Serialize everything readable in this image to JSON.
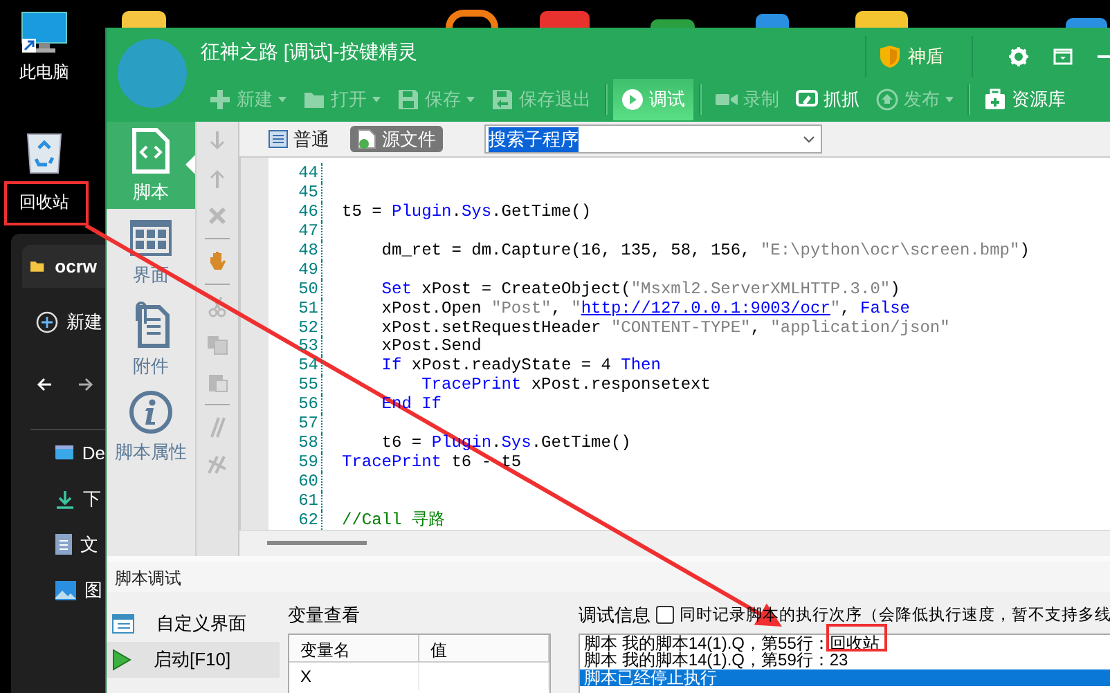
{
  "desktop": {
    "icons": [
      {
        "label": "此电脑",
        "kind": "computer"
      },
      {
        "label": "回收站",
        "kind": "recycle"
      }
    ]
  },
  "explorer": {
    "tab": "ocrw",
    "new_button": "新建",
    "nav": [
      {
        "label": "De",
        "kind": "desktop"
      },
      {
        "label": "下",
        "kind": "download"
      },
      {
        "label": "文",
        "kind": "document"
      },
      {
        "label": "图",
        "kind": "picture"
      }
    ]
  },
  "window": {
    "title": "征神之路 [调试]-按键精灵",
    "shield": "神盾"
  },
  "toolbar": [
    {
      "label": "新建",
      "disabled": true,
      "dropdown": true,
      "selected": false
    },
    {
      "label": "打开",
      "disabled": true,
      "dropdown": true,
      "selected": false
    },
    {
      "label": "保存",
      "disabled": true,
      "dropdown": true,
      "selected": false
    },
    {
      "label": "保存退出",
      "disabled": true,
      "dropdown": false,
      "selected": false
    },
    {
      "label": "调试",
      "disabled": false,
      "dropdown": false,
      "selected": true
    },
    {
      "label": "录制",
      "disabled": true,
      "dropdown": false,
      "selected": false
    },
    {
      "label": "抓抓",
      "disabled": false,
      "dropdown": false,
      "selected": false
    },
    {
      "label": "发布",
      "disabled": true,
      "dropdown": true,
      "selected": false
    },
    {
      "label": "资源库",
      "disabled": false,
      "dropdown": false,
      "selected": false
    }
  ],
  "sidebar": {
    "items": [
      {
        "label": "脚本",
        "selected": true
      },
      {
        "label": "界面",
        "selected": false
      },
      {
        "label": "附件",
        "selected": false
      },
      {
        "label": "脚本属性",
        "selected": false
      }
    ]
  },
  "editor": {
    "view_tabs": [
      {
        "label": "普通",
        "selected": false
      },
      {
        "label": "源文件",
        "selected": true
      }
    ],
    "procedure_search": {
      "value": "搜索子程序"
    },
    "lines": [
      {
        "number": "44"
      },
      {
        "number": "45"
      },
      {
        "number": "46",
        "segments": [
          {
            "kind": "plain",
            "text": "t5 = "
          },
          {
            "kind": "keyword",
            "text": "Plugin"
          },
          {
            "kind": "plain",
            "text": "."
          },
          {
            "kind": "keyword",
            "text": "Sys"
          },
          {
            "kind": "plain",
            "text": ".GetTime()"
          }
        ]
      },
      {
        "number": "47"
      },
      {
        "number": "48",
        "segments": [
          {
            "kind": "plain",
            "text": "    dm_ret = dm.Capture(16, 135, 58, 156, "
          },
          {
            "kind": "string",
            "text": "\"E:\\python\\ocr\\screen.bmp\""
          },
          {
            "kind": "plain",
            "text": ")"
          }
        ]
      },
      {
        "number": "49"
      },
      {
        "number": "50",
        "segments": [
          {
            "kind": "keyword",
            "text": "    Set"
          },
          {
            "kind": "plain",
            "text": " xPost = CreateObject("
          },
          {
            "kind": "string",
            "text": "\"Msxml2.ServerXMLHTTP.3.0\""
          },
          {
            "kind": "plain",
            "text": ")"
          }
        ]
      },
      {
        "number": "51",
        "segments": [
          {
            "kind": "plain",
            "text": "    xPost.Open "
          },
          {
            "kind": "string",
            "text": "\"Post\""
          },
          {
            "kind": "plain",
            "text": ", "
          },
          {
            "kind": "string",
            "text": "\""
          },
          {
            "kind": "link",
            "text": "http://127.0.0.1:9003/ocr"
          },
          {
            "kind": "string",
            "text": "\""
          },
          {
            "kind": "plain",
            "text": ", "
          },
          {
            "kind": "keyword",
            "text": "False"
          }
        ]
      },
      {
        "number": "52",
        "segments": [
          {
            "kind": "plain",
            "text": "    xPost.setRequestHeader "
          },
          {
            "kind": "string",
            "text": "\"CONTENT-TYPE\""
          },
          {
            "kind": "plain",
            "text": ", "
          },
          {
            "kind": "string",
            "text": "\"application/json\""
          }
        ]
      },
      {
        "number": "53",
        "segments": [
          {
            "kind": "plain",
            "text": "    xPost.Send"
          }
        ]
      },
      {
        "number": "54",
        "segments": [
          {
            "kind": "keyword",
            "text": "    If"
          },
          {
            "kind": "plain",
            "text": " xPost.readyState = 4 "
          },
          {
            "kind": "keyword",
            "text": "Then"
          }
        ]
      },
      {
        "number": "55",
        "segments": [
          {
            "kind": "keyword",
            "text": "        TracePrint"
          },
          {
            "kind": "plain",
            "text": " xPost.responsetext"
          }
        ]
      },
      {
        "number": "56",
        "segments": [
          {
            "kind": "keyword",
            "text": "    End If"
          }
        ]
      },
      {
        "number": "57"
      },
      {
        "number": "58",
        "segments": [
          {
            "kind": "plain",
            "text": "    t6 = "
          },
          {
            "kind": "keyword",
            "text": "Plugin"
          },
          {
            "kind": "plain",
            "text": "."
          },
          {
            "kind": "keyword",
            "text": "Sys"
          },
          {
            "kind": "plain",
            "text": ".GetTime()"
          }
        ]
      },
      {
        "number": "59",
        "segments": [
          {
            "kind": "keyword",
            "text": "TracePrint"
          },
          {
            "kind": "plain",
            "text": " t6 - t5"
          }
        ]
      },
      {
        "number": "60"
      },
      {
        "number": "61"
      },
      {
        "number": "62",
        "segments": [
          {
            "kind": "comment",
            "text": "//Call 寻路"
          }
        ]
      }
    ]
  },
  "debug_panel": {
    "title": "脚本调试",
    "actions": [
      {
        "label": "自定义界面",
        "selected": false
      },
      {
        "label": "启动[F10]",
        "selected": true
      }
    ],
    "variables": {
      "label": "变量查看",
      "columns": [
        "变量名",
        "值"
      ],
      "rows": [
        [
          "X",
          ""
        ]
      ]
    },
    "info": {
      "label": "调试信息",
      "record_order": {
        "label": "同时记录脚本的执行次序（会降低执行速度，暂不支持多线",
        "checked": false
      },
      "log": [
        {
          "text": "脚本 我的脚本14(1).Q，第55行：回收站",
          "selected": false
        },
        {
          "text": "脚本 我的脚本14(1).Q，第59行：23",
          "selected": false
        },
        {
          "text": "脚本已经停止执行",
          "selected": true
        }
      ]
    }
  }
}
